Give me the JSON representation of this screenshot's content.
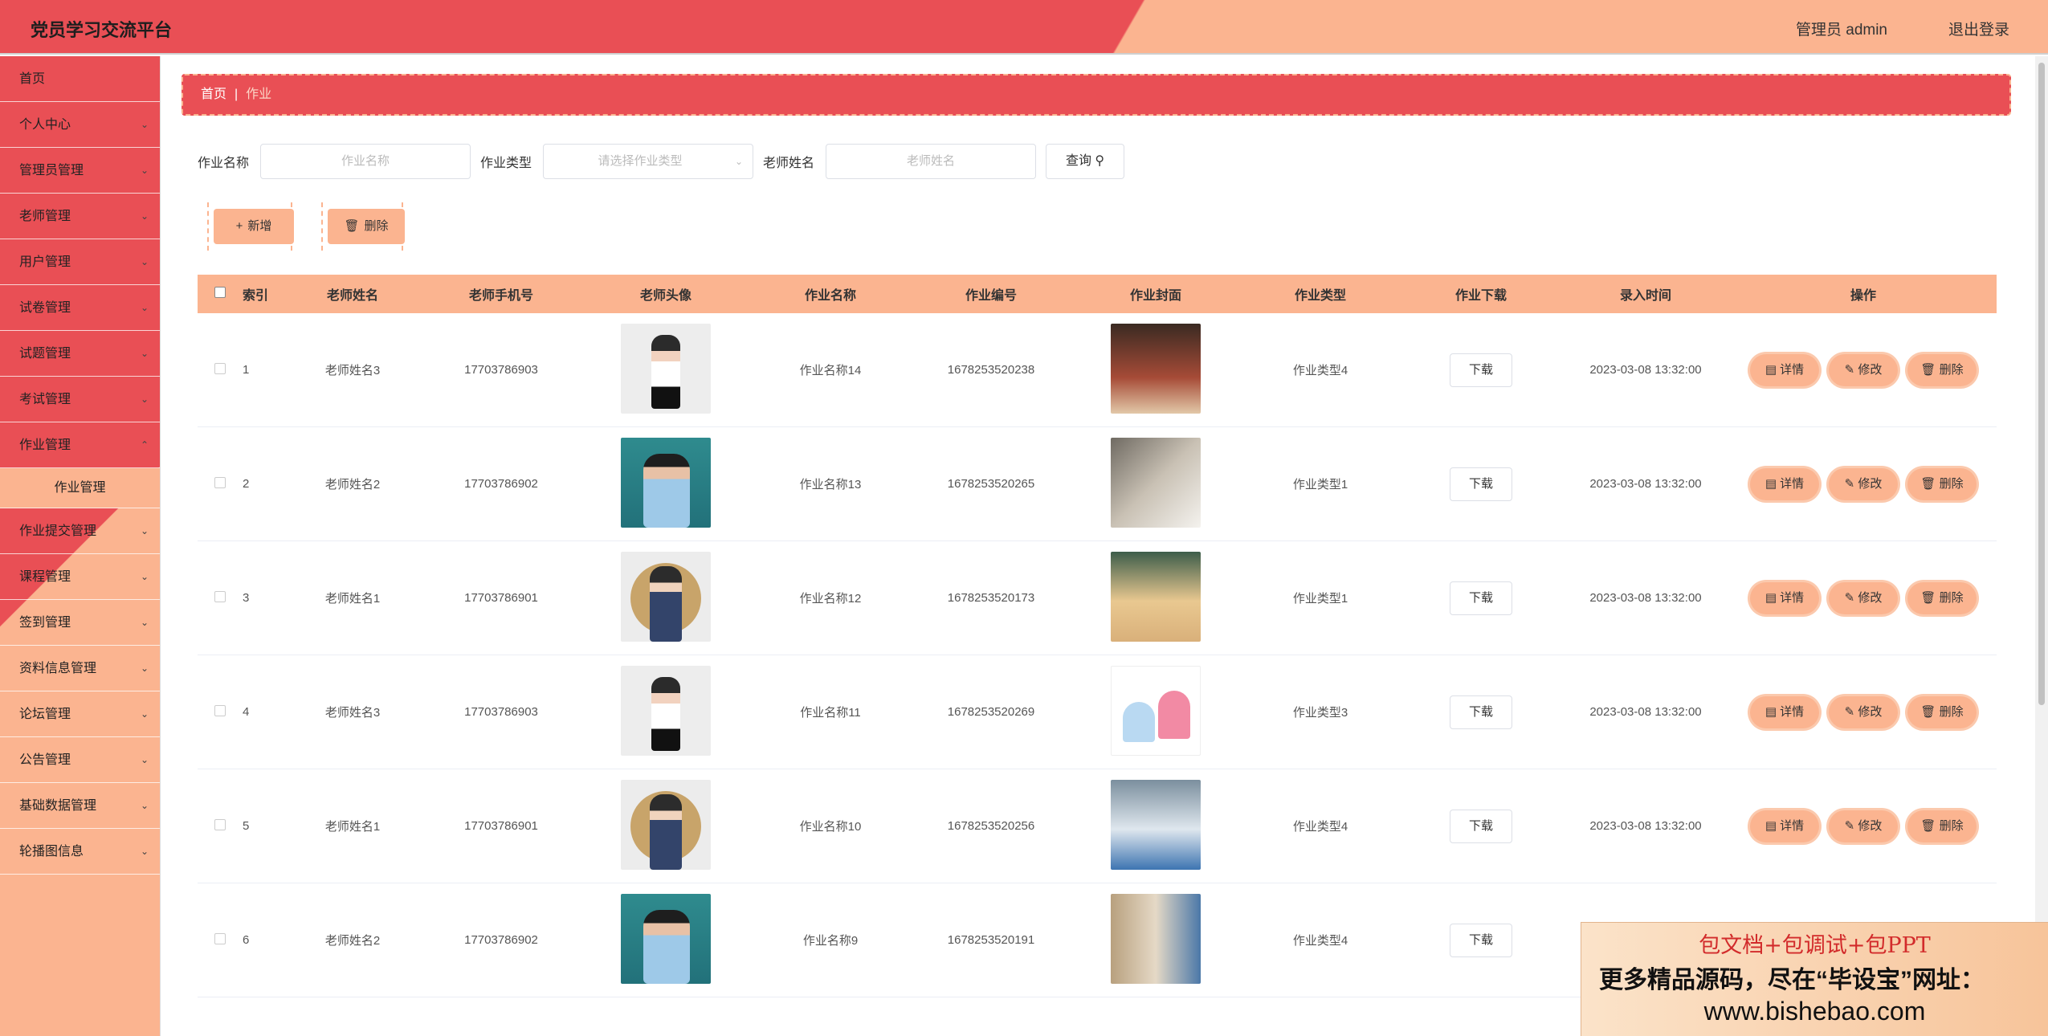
{
  "header": {
    "title": "党员学习交流平台",
    "user": "管理员 admin",
    "logout": "退出登录"
  },
  "sidebar": {
    "items": [
      {
        "label": "首页",
        "has_children": false
      },
      {
        "label": "个人中心",
        "has_children": true
      },
      {
        "label": "管理员管理",
        "has_children": true
      },
      {
        "label": "老师管理",
        "has_children": true
      },
      {
        "label": "用户管理",
        "has_children": true
      },
      {
        "label": "试卷管理",
        "has_children": true
      },
      {
        "label": "试题管理",
        "has_children": true
      },
      {
        "label": "考试管理",
        "has_children": true
      },
      {
        "label": "作业管理",
        "has_children": true,
        "expanded": true
      },
      {
        "label": "作业管理",
        "sub": true,
        "active": true
      },
      {
        "label": "作业提交管理",
        "has_children": true
      },
      {
        "label": "课程管理",
        "has_children": true
      },
      {
        "label": "签到管理",
        "has_children": true
      },
      {
        "label": "资料信息管理",
        "has_children": true
      },
      {
        "label": "论坛管理",
        "has_children": true
      },
      {
        "label": "公告管理",
        "has_children": true
      },
      {
        "label": "基础数据管理",
        "has_children": true
      },
      {
        "label": "轮播图信息",
        "has_children": true
      }
    ]
  },
  "breadcrumb": {
    "home": "首页",
    "separator": "|",
    "current": "作业"
  },
  "search": {
    "name_label": "作业名称",
    "name_placeholder": "作业名称",
    "type_label": "作业类型",
    "type_placeholder": "请选择作业类型",
    "teacher_label": "老师姓名",
    "teacher_placeholder": "老师姓名",
    "query_label": "查询"
  },
  "actions": {
    "add": "新增",
    "delete": "删除"
  },
  "table": {
    "headers": [
      "索引",
      "老师姓名",
      "老师手机号",
      "老师头像",
      "作业名称",
      "作业编号",
      "作业封面",
      "作业类型",
      "作业下载",
      "录入时间",
      "操作"
    ],
    "download_label": "下载",
    "op_labels": {
      "detail": "详情",
      "edit": "修改",
      "delete": "删除"
    },
    "rows": [
      {
        "index": "1",
        "teacher": "老师姓名3",
        "phone": "17703786903",
        "avatar": "teacher-3-photo",
        "name": "作业名称14",
        "code": "1678253520238",
        "cover": "girl-reading-cover",
        "type": "作业类型4",
        "time": "2023-03-08 13:32:00"
      },
      {
        "index": "2",
        "teacher": "老师姓名2",
        "phone": "17703786902",
        "avatar": "teacher-2-photo",
        "name": "作业名称13",
        "code": "1678253520265",
        "cover": "writing-desk-cover",
        "type": "作业类型1",
        "time": "2023-03-08 13:32:00"
      },
      {
        "index": "3",
        "teacher": "老师姓名1",
        "phone": "17703786901",
        "avatar": "teacher-1-photo",
        "name": "作业名称12",
        "code": "1678253520173",
        "cover": "child-homework-cover",
        "type": "作业类型1",
        "time": "2023-03-08 13:32:00"
      },
      {
        "index": "4",
        "teacher": "老师姓名3",
        "phone": "17703786903",
        "avatar": "teacher-3-photo",
        "name": "作业名称11",
        "code": "1678253520269",
        "cover": "cartoon-kids-cover",
        "type": "作业类型3",
        "time": "2023-03-08 13:32:00"
      },
      {
        "index": "5",
        "teacher": "老师姓名1",
        "phone": "17703786901",
        "avatar": "teacher-1-photo",
        "name": "作业名称10",
        "code": "1678253520256",
        "cover": "boy-writing-cover",
        "type": "作业类型4",
        "time": "2023-03-08 13:32:00"
      },
      {
        "index": "6",
        "teacher": "老师姓名2",
        "phone": "17703786902",
        "avatar": "teacher-2-photo",
        "name": "作业名称9",
        "code": "1678253520191",
        "cover": "boy-books-cover",
        "type": "作业类型4",
        "time": ""
      }
    ]
  },
  "ad": {
    "line1": "包文档+包调试+包PPT",
    "line2": "更多精品源码，尽在“毕设宝”网址：",
    "line3": "www.bishebao.com"
  },
  "colors": {
    "primary": "#e94f55",
    "accent": "#fbb490"
  }
}
